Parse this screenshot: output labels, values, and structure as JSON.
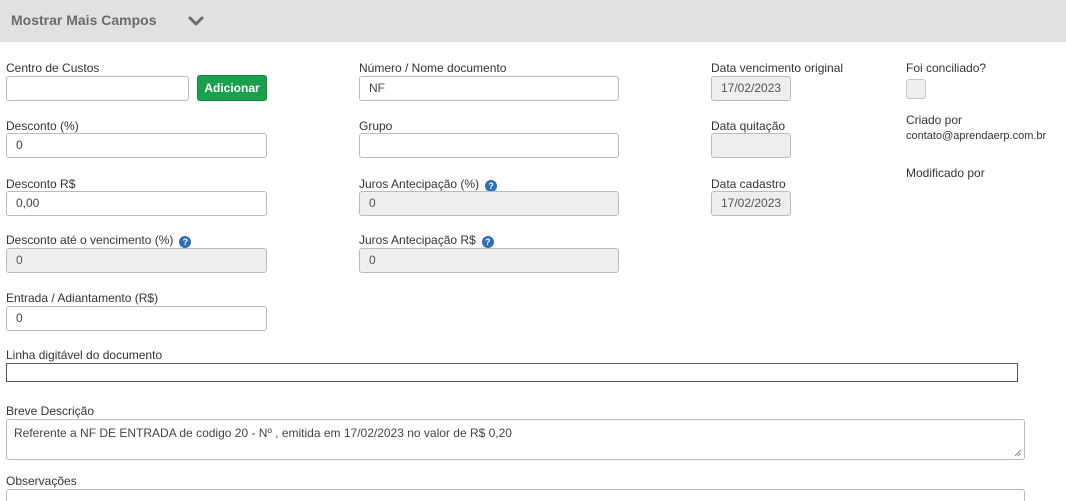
{
  "header": {
    "title": "Mostrar Mais Campos",
    "chevron_icon": "chevron-down-icon"
  },
  "centro_custos": {
    "label": "Centro de Custos",
    "value": "",
    "button": "Adicionar"
  },
  "desconto_pct": {
    "label": "Desconto (%)",
    "value": "0"
  },
  "desconto_rs": {
    "label": "Desconto R$",
    "value": "0,00"
  },
  "desconto_venc": {
    "label": "Desconto até o vencimento (%)",
    "value": "0"
  },
  "entrada": {
    "label": "Entrada / Adiantamento (R$)",
    "value": "0"
  },
  "numero_doc": {
    "label": "Número / Nome documento",
    "value": "NF"
  },
  "grupo": {
    "label": "Grupo",
    "value": ""
  },
  "juros_pct": {
    "label": "Juros Antecipação (%)",
    "value": "0"
  },
  "juros_rs": {
    "label": "Juros Antecipação R$",
    "value": "0"
  },
  "data_venc": {
    "label": "Data vencimento original",
    "value": "17/02/2023"
  },
  "data_quitacao": {
    "label": "Data quitação",
    "value": ""
  },
  "data_cadastro": {
    "label": "Data cadastro",
    "value": "17/02/2023"
  },
  "conciliado": {
    "label": "Foi conciliado?",
    "checked": false
  },
  "criado_por": {
    "label": "Criado por",
    "value": "contato@aprendaerp.com.br"
  },
  "modificado_por": {
    "label": "Modificado por",
    "value": ""
  },
  "linha_digitavel": {
    "label": "Linha digitável do documento",
    "value": ""
  },
  "breve_descricao": {
    "label": "Breve Descrição",
    "value": "Referente a NF DE ENTRADA de codigo 20 - Nº , emitida em 17/02/2023 no valor de R$ 0,20"
  },
  "observacoes": {
    "label": "Observações",
    "value": ""
  },
  "help_icon_glyph": "?"
}
